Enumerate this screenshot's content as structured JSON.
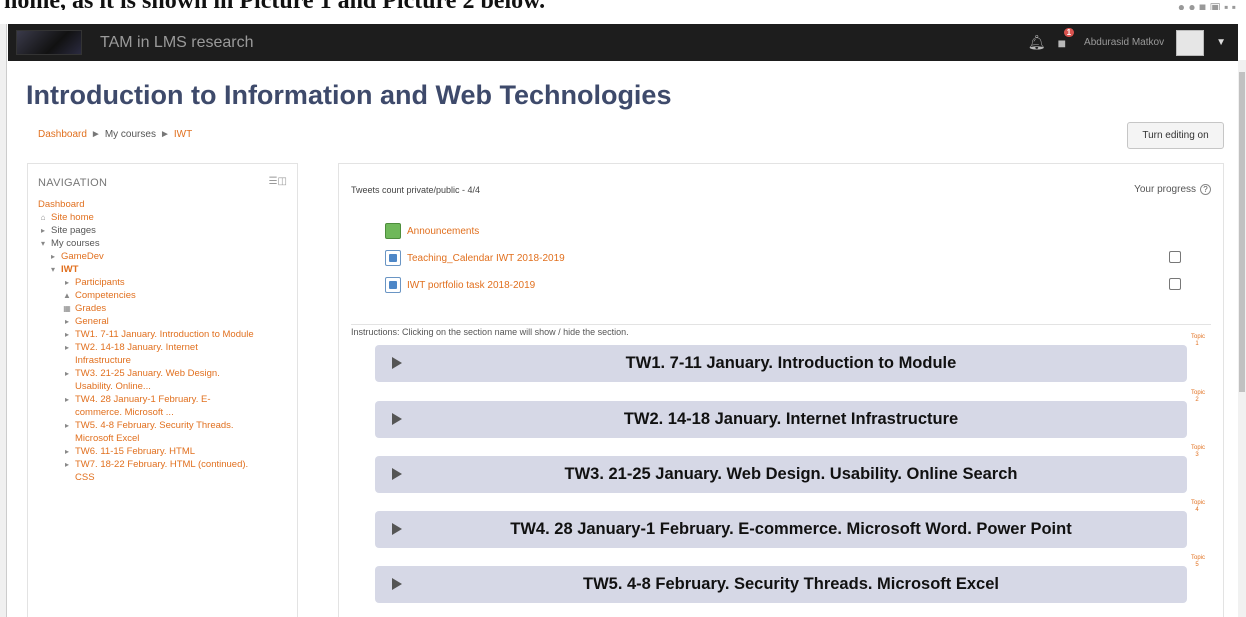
{
  "document_crop": {
    "text": "home, as it is shown in Picture 1 and Picture 2 below."
  },
  "navbar": {
    "site_name": "TAM in LMS research",
    "notifications_icon": "bell-icon",
    "messages_icon": "speech-bubble-icon",
    "message_count": "1",
    "user_name": "Abdurasid Matkov"
  },
  "page": {
    "title": "Introduction to Information and Web Technologies",
    "breadcrumb": [
      "Dashboard",
      "My courses",
      "IWT"
    ],
    "edit_button": "Turn editing on"
  },
  "navigation": {
    "title": "NAVIGATION",
    "items": [
      {
        "label": "Dashboard",
        "color": "orange",
        "icon": ""
      },
      {
        "label": "Site home",
        "color": "orange",
        "icon": "home-icon"
      },
      {
        "label": "Site pages",
        "color": "dark",
        "icon": "chevron-right"
      },
      {
        "label": "My courses",
        "color": "dark",
        "icon": "chevron-down"
      },
      {
        "label": "GameDev",
        "color": "orange",
        "icon": "chevron-right"
      },
      {
        "label": "IWT",
        "color": "orange",
        "icon": "chevron-down"
      },
      {
        "label": "Participants",
        "color": "orange",
        "icon": "chevron-right"
      },
      {
        "label": "Competencies",
        "color": "orange",
        "icon": "competency-icon"
      },
      {
        "label": "Grades",
        "color": "orange",
        "icon": "grades-icon"
      },
      {
        "label": "General",
        "color": "orange",
        "icon": "chevron-right"
      },
      {
        "label": "TW1. 7-11 January. Introduction to Module",
        "color": "orange",
        "icon": "chevron-right"
      },
      {
        "label": "TW2. 14-18 January. Internet Infrastructure",
        "color": "orange",
        "icon": "chevron-right"
      },
      {
        "label": "TW3. 21-25 January. Web Design. Usability. Online...",
        "color": "orange",
        "icon": "chevron-right"
      },
      {
        "label": "TW4. 28 January-1 February. E-commerce. Microsoft ...",
        "color": "orange",
        "icon": "chevron-right"
      },
      {
        "label": "TW5. 4-8 February. Security Threads. Microsoft Excel",
        "color": "orange",
        "icon": "chevron-right"
      },
      {
        "label": "TW6. 11-15 February. HTML",
        "color": "orange",
        "icon": "chevron-right"
      },
      {
        "label": "TW7. 18-22 February. HTML (continued). CSS",
        "color": "orange",
        "icon": "chevron-right"
      }
    ]
  },
  "main": {
    "tweets_count": "Tweets count private/public - 4/4",
    "your_progress": "Your progress",
    "activities": [
      {
        "label": "Announcements",
        "icon": "forum-icon",
        "has_checkbox": false
      },
      {
        "label": "Teaching_Calendar IWT 2018-2019",
        "icon": "file-icon",
        "has_checkbox": true
      },
      {
        "label": "IWT portfolio task 2018-2019",
        "icon": "file-icon",
        "has_checkbox": true
      }
    ],
    "instructions": "Instructions: Clicking on the section name will show / hide the section.",
    "sections": [
      {
        "title": "TW1. 7-11 January. Introduction to Module",
        "tag": "Topic 1"
      },
      {
        "title": "TW2. 14-18 January. Internet Infrastructure",
        "tag": "Topic 2"
      },
      {
        "title": "TW3. 21-25 January. Web Design. Usability. Online Search",
        "tag": "Topic 3"
      },
      {
        "title": "TW4. 28 January-1 February. E-commerce. Microsoft Word. Power Point",
        "tag": "Topic 4"
      },
      {
        "title": "TW5. 4-8 February. Security Threads. Microsoft Excel",
        "tag": "Topic 5"
      }
    ]
  },
  "colors": {
    "link": "#e1701f",
    "section_bg": "#d6d8e6",
    "navbar_bg": "#1d1d1d",
    "title": "#3e4a6b"
  }
}
